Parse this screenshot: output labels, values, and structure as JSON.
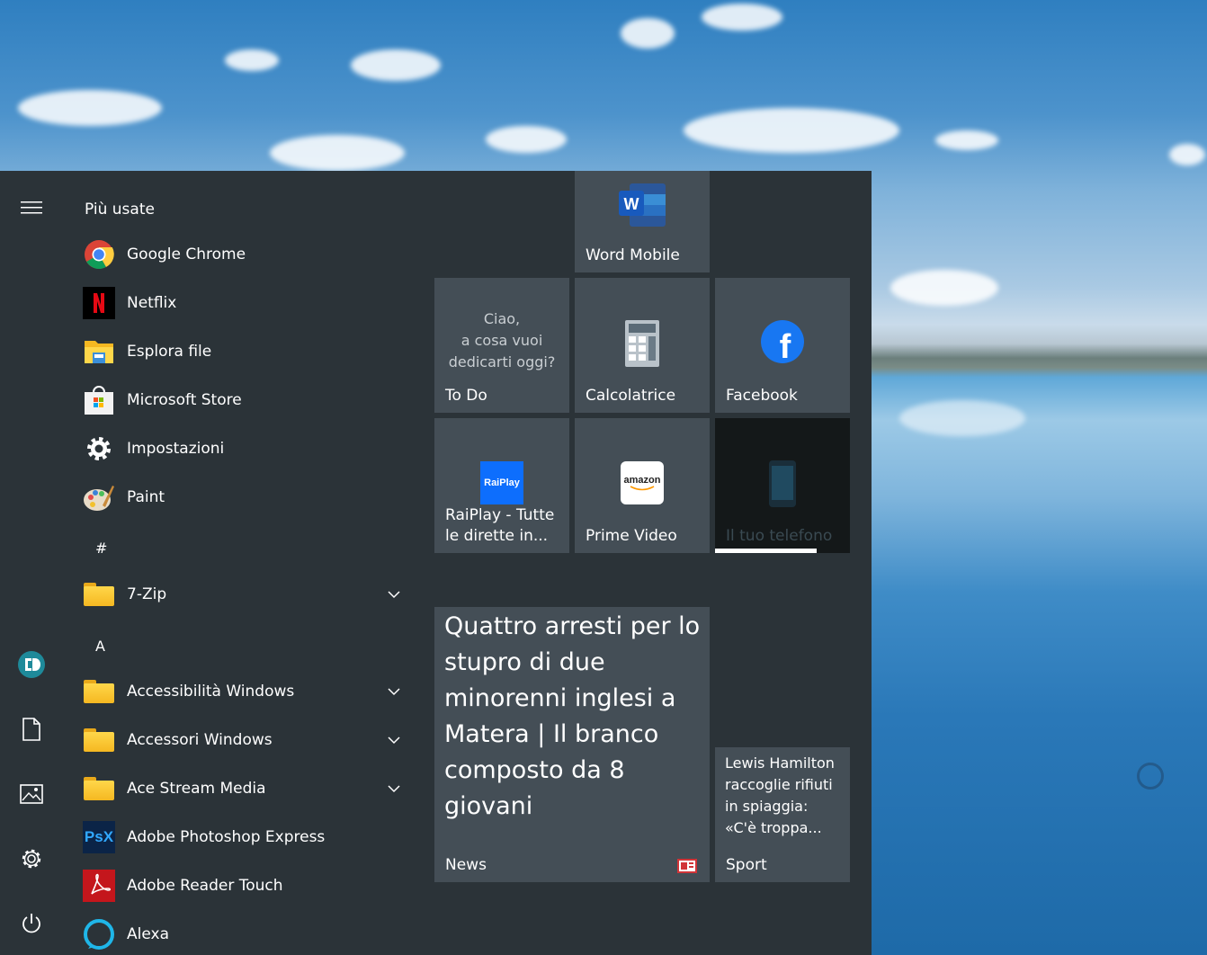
{
  "start_menu": {
    "most_used_header": "Più usate",
    "apps": [
      {
        "label": "Google Chrome",
        "icon": "chrome-icon"
      },
      {
        "label": "Netflix",
        "icon": "netflix-icon"
      },
      {
        "label": "Esplora file",
        "icon": "file-explorer-icon"
      },
      {
        "label": "Microsoft Store",
        "icon": "store-icon"
      },
      {
        "label": "Impostazioni",
        "icon": "settings-gear-icon"
      },
      {
        "label": "Paint",
        "icon": "paint-icon"
      }
    ],
    "letters": [
      "#",
      "A"
    ],
    "list": [
      {
        "label": "7-Zip",
        "icon": "folder-icon"
      },
      {
        "label": "Accessibilità Windows",
        "icon": "folder-icon"
      },
      {
        "label": "Accessori Windows",
        "icon": "folder-icon"
      },
      {
        "label": "Ace Stream Media",
        "icon": "folder-icon"
      },
      {
        "label": "Adobe Photoshop Express",
        "icon": "photoshop-express-icon",
        "badge": "PsX"
      },
      {
        "label": "Adobe Reader Touch",
        "icon": "adobe-reader-icon"
      },
      {
        "label": "Alexa",
        "icon": "alexa-icon"
      }
    ]
  },
  "tiles": {
    "word": {
      "label": "Word Mobile",
      "letter": "W"
    },
    "todo": {
      "label": "To Do",
      "greeting_1": "Ciao,",
      "greeting_2": "a cosa vuoi",
      "greeting_3": "dedicarti oggi?"
    },
    "calc": {
      "label": "Calcolatrice"
    },
    "facebook": {
      "label": "Facebook",
      "letter": "f"
    },
    "raiplay": {
      "label_1": "RaiPlay - Tutte",
      "label_2": "le dirette in...",
      "logo": "RaiPlay"
    },
    "prime": {
      "label": "Prime Video",
      "logo": "amazon"
    },
    "phone": {
      "label": "Il tuo telefono",
      "progress": 0.75
    },
    "news": {
      "headline_1": "Quattro arresti per lo",
      "headline_2": "stupro di due",
      "headline_3": "minorenni inglesi a",
      "headline_4": "Matera | Il branco",
      "headline_5": "composto da 8",
      "headline_6": "giovani",
      "label": "News"
    },
    "sport": {
      "headline_1": "Lewis Hamilton",
      "headline_2": "raccoglie rifiuti",
      "headline_3": "in spiaggia:",
      "headline_4": "«C'è troppa...",
      "label": "Sport"
    }
  },
  "colors": {
    "menu_bg": "#2b3338",
    "tile_bg": "#444e56",
    "accent_chrome": "#db4437",
    "facebook_blue": "#1877f2"
  }
}
